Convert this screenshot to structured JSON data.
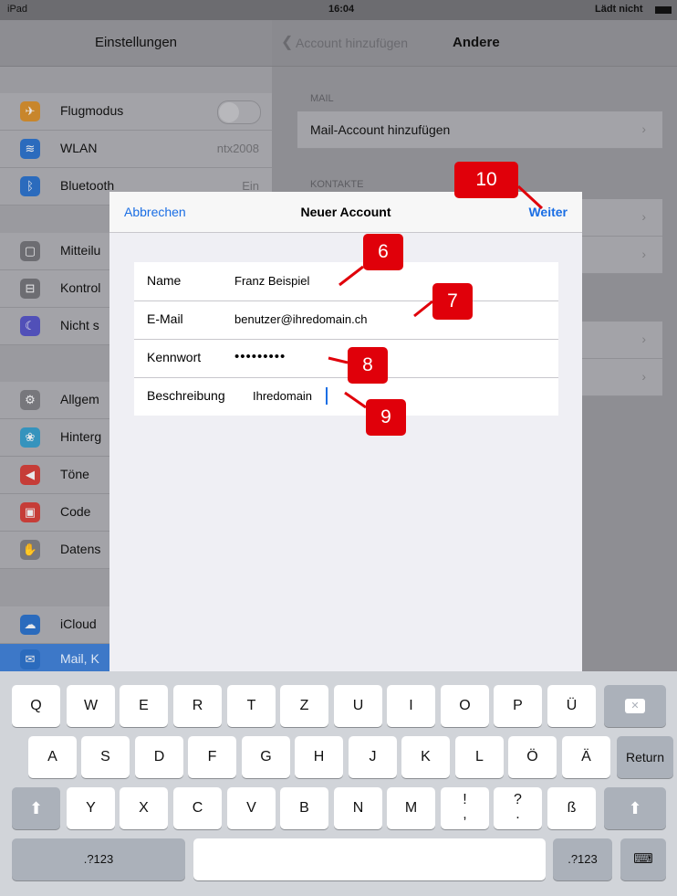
{
  "status": {
    "device": "iPad",
    "time": "16:04",
    "battery": "Lädt nicht"
  },
  "left": {
    "title": "Einstellungen",
    "items": [
      {
        "label": "Flugmodus",
        "value": "",
        "icon": "airplane-icon",
        "color": "#f0a030"
      },
      {
        "label": "WLAN",
        "value": "ntx2008",
        "icon": "wifi-icon",
        "color": "#2f7de1"
      },
      {
        "label": "Bluetooth",
        "value": "Ein",
        "icon": "bluetooth-icon",
        "color": "#2f7de1"
      },
      {
        "label": "Mitteilu",
        "icon": "notification-icon",
        "color": "#7b7b80"
      },
      {
        "label": "Kontrol",
        "icon": "control-icon",
        "color": "#7b7b80"
      },
      {
        "label": "Nicht s",
        "icon": "moon-icon",
        "color": "#5856d6"
      },
      {
        "label": "Allgem",
        "icon": "gear-icon",
        "color": "#8e8e93"
      },
      {
        "label": "Hinterg",
        "icon": "flower-icon",
        "color": "#34aadc"
      },
      {
        "label": "Töne",
        "icon": "speaker-icon",
        "color": "#ff3b30"
      },
      {
        "label": "Code",
        "icon": "lock-icon",
        "color": "#ff3b30"
      },
      {
        "label": "Datens",
        "icon": "hand-icon",
        "color": "#8e8e93"
      },
      {
        "label": "iCloud",
        "icon": "cloud-icon",
        "color": "#2f7de1"
      },
      {
        "label": "Mail, K",
        "icon": "mail-icon",
        "color": "#2f7de1"
      }
    ]
  },
  "right": {
    "back": "Account hinzufügen",
    "title": "Andere",
    "section_mail": "MAIL",
    "mail_row": "Mail-Account hinzufügen",
    "section_contacts": "KONTAKTE"
  },
  "modal": {
    "cancel": "Abbrechen",
    "title": "Neuer Account",
    "next": "Weiter",
    "fields": [
      {
        "label": "Name",
        "value": "Franz Beispiel"
      },
      {
        "label": "E-Mail",
        "value": "benutzer@ihredomain.ch"
      },
      {
        "label": "Kennwort",
        "value": "•••••••••"
      },
      {
        "label": "Beschreibung",
        "value": "Ihredomain"
      }
    ]
  },
  "callouts": [
    "6",
    "7",
    "8",
    "9",
    "10"
  ],
  "keyboard": {
    "row1": [
      "Q",
      "W",
      "E",
      "R",
      "T",
      "Z",
      "U",
      "I",
      "O",
      "P",
      "Ü"
    ],
    "row2": [
      "A",
      "S",
      "D",
      "F",
      "G",
      "H",
      "J",
      "K",
      "L",
      "Ö",
      "Ä"
    ],
    "row3": [
      "Y",
      "X",
      "C",
      "V",
      "B",
      "N",
      "M",
      "!",
      ",",
      "?",
      ".",
      "ß"
    ],
    "return": "Return",
    "numbers": ".?123"
  }
}
